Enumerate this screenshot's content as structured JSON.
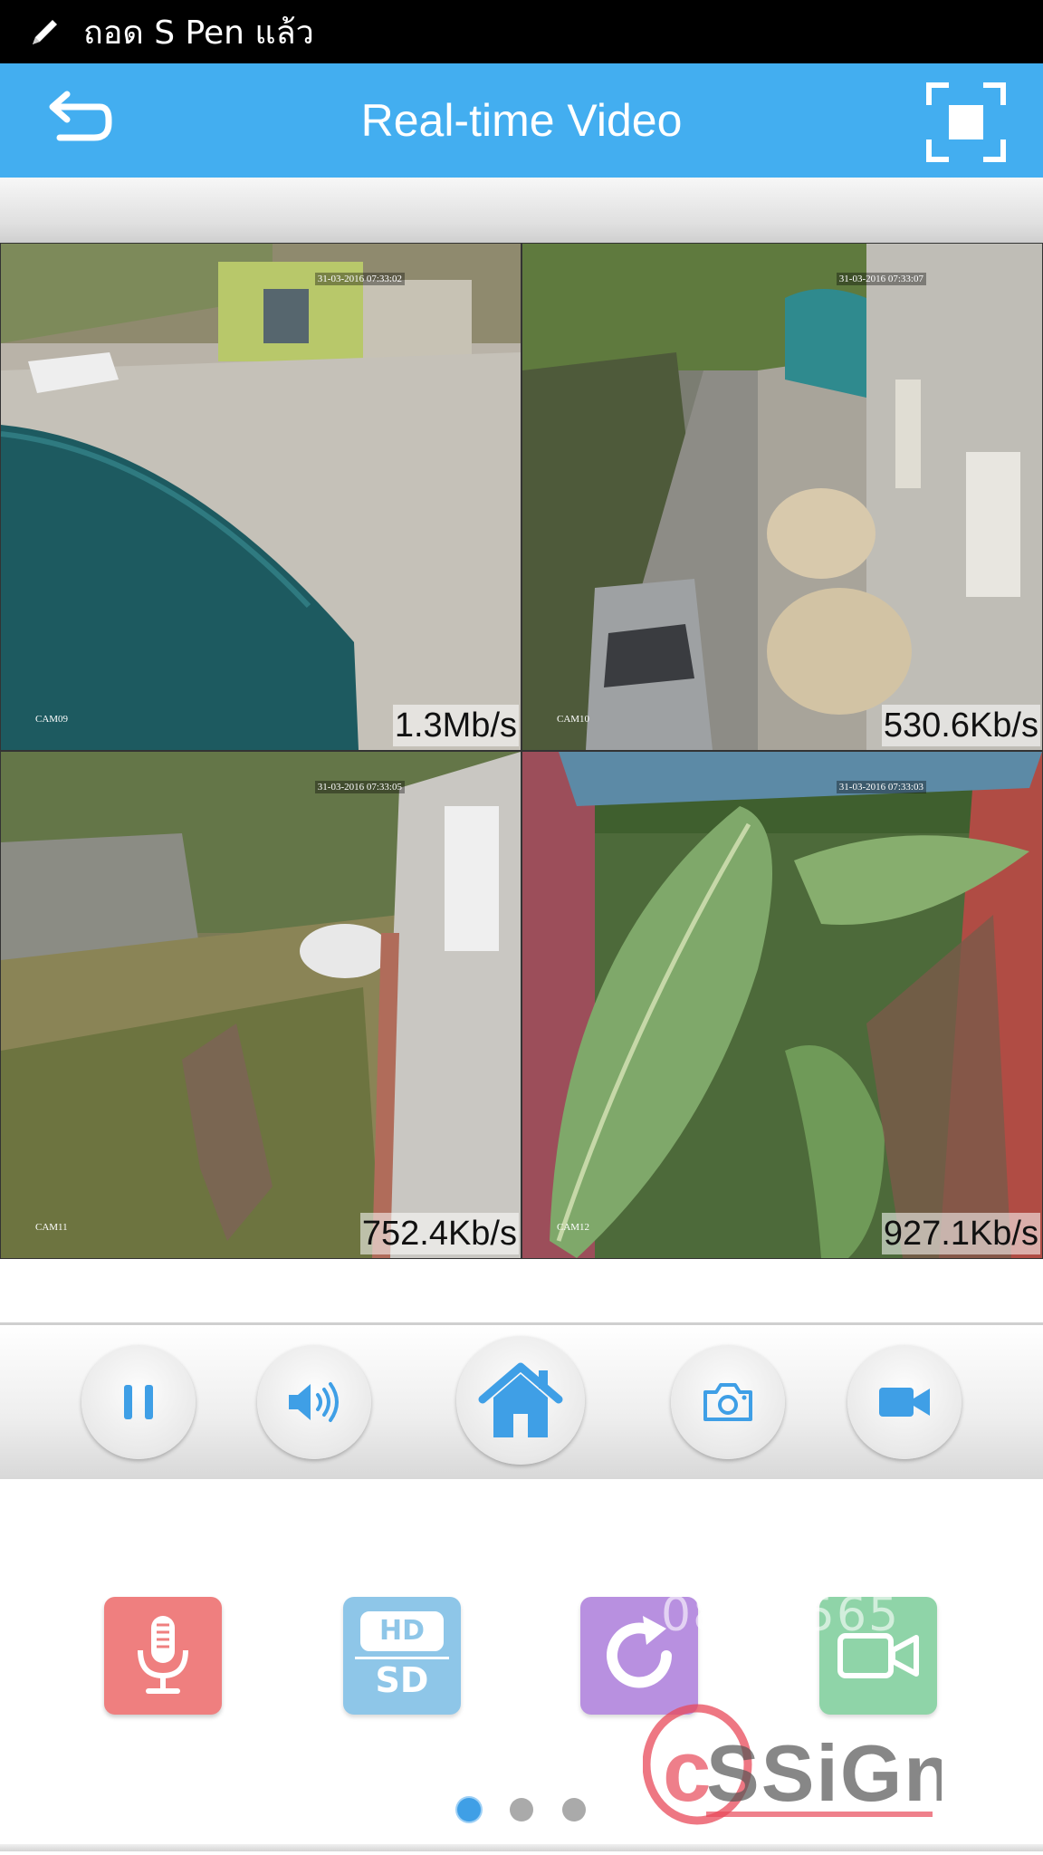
{
  "status_bar": {
    "text": "ถอด S Pen แล้ว",
    "icon": "pen-icon"
  },
  "app_bar": {
    "title": "Real-time Video",
    "back_icon": "back-arrow-icon",
    "fullscreen_icon": "fullscreen-icon",
    "color": "#43aef0"
  },
  "video_grid": {
    "tiles": [
      {
        "camera": "CAM09",
        "bitrate": "1.3Mb/s",
        "timestamp": "31-03-2016 07:33:02"
      },
      {
        "camera": "CAM10",
        "bitrate": "530.6Kb/s",
        "timestamp": "31-03-2016 07:33:07"
      },
      {
        "camera": "CAM11",
        "bitrate": "752.4Kb/s",
        "timestamp": "31-03-2016 07:33:05"
      },
      {
        "camera": "CAM12",
        "bitrate": "927.1Kb/s",
        "timestamp": "31-03-2016 07:33:03"
      }
    ]
  },
  "controls": {
    "buttons": [
      "pause-icon",
      "speaker-icon",
      "home-icon",
      "camera-icon",
      "video-camera-icon"
    ],
    "icon_color": "#3f9fe6"
  },
  "apps": {
    "items": [
      {
        "icon": "microphone-icon",
        "color": "#ef7f7f"
      },
      {
        "icon": "hd-sd-icon",
        "hd": "HD",
        "sd": "SD",
        "color": "#8ec6e8"
      },
      {
        "icon": "rotate-icon",
        "color": "#b890e0"
      },
      {
        "icon": "record-video-icon",
        "color": "#8fd4a8"
      }
    ],
    "page_dots": 3,
    "active_dot": 0
  },
  "watermark": {
    "text": "cossign",
    "phone_fragment": "08 27565"
  }
}
